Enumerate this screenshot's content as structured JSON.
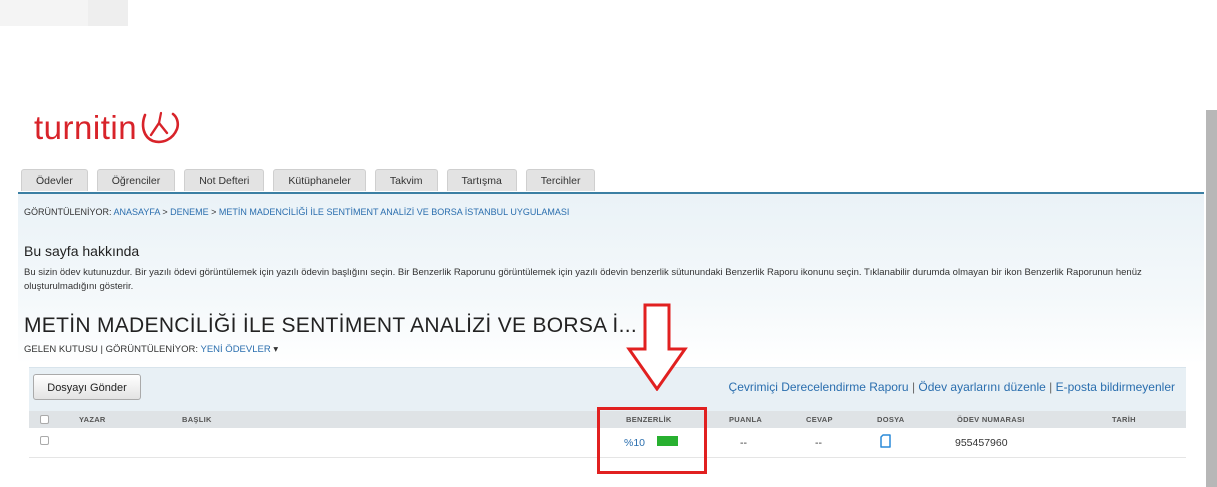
{
  "logo": {
    "text": "turnitin"
  },
  "tabs": [
    "Ödevler",
    "Öğrenciler",
    "Not Defteri",
    "Kütüphaneler",
    "Takvim",
    "Tartışma",
    "Tercihler"
  ],
  "breadcrumb": {
    "prefix": "GÖRÜNTÜLENİYOR: ",
    "home": "ANASAYFA",
    "sep1": " > ",
    "class": "DENEME",
    "sep2": " > ",
    "assignment": "METİN MADENCİLİĞİ İLE SENTİMENT ANALİZİ VE BORSA İSTANBUL UYGULAMASI"
  },
  "about": {
    "title": "Bu sayfa hakkında",
    "text": "Bu sizin ödev kutunuzdur. Bir yazılı ödevi görüntülemek için yazılı ödevin başlığını seçin. Bir Benzerlik Raporunu görüntülemek için yazılı ödevin benzerlik sütunundaki Benzerlik Raporu ikonunu seçin. Tıklanabilir durumda olmayan bir ikon Benzerlik Raporunun henüz oluşturulmadığını gösterir."
  },
  "assignment": {
    "title": "METİN MADENCİLİĞİ İLE SENTİMENT ANALİZİ VE BORSA İ...",
    "inbox_label": "GELEN KUTUSU",
    "view_sep": "  |  ",
    "view_prefix": "GÖRÜNTÜLENİYOR: ",
    "view_value": "YENİ ÖDEVLER",
    "view_caret": " ▾"
  },
  "toolbar": {
    "submit_label": "Dosyayı Gönder",
    "online_grading": "Çevrimiçi Derecelendirme Raporu",
    "sep": " | ",
    "edit_settings": "Ödev ayarlarını düzenle",
    "sep2": " | ",
    "email_non": "E-posta bildirmeyenler"
  },
  "table": {
    "headers": {
      "author": "YAZAR",
      "title": "BAŞLIK",
      "similarity": "BENZERLİK",
      "grade": "PUANLA",
      "response": "CEVAP",
      "file": "DOSYA",
      "paper_id": "ÖDEV NUMARASI",
      "date": "TARİH"
    },
    "rows": [
      {
        "author": "",
        "title": "",
        "similarity": "%10",
        "similarity_level": 0.1,
        "grade": "--",
        "response": "--",
        "file_icon": "document-icon",
        "paper_id": "955457960",
        "date": ""
      }
    ]
  },
  "colors": {
    "brand_red": "#d8232a",
    "link_blue": "#2a6eae",
    "similarity_green": "#28b030",
    "annotation_red": "#e12020"
  }
}
